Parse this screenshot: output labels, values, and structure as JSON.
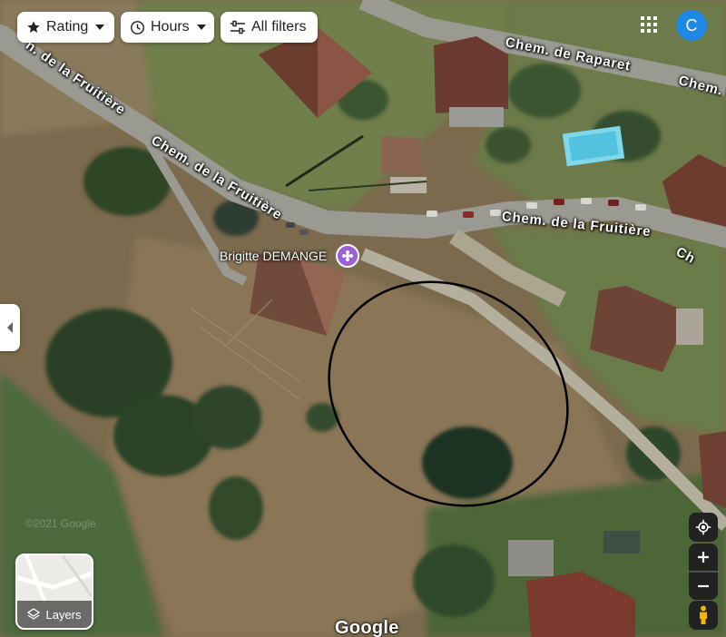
{
  "filters": {
    "rating_label": "Rating",
    "hours_label": "Hours",
    "all_filters_label": "All filters"
  },
  "account": {
    "initial": "C"
  },
  "roads": {
    "raparet": "Chem. de Raparet",
    "raparet_edge": "Chem.",
    "fruitiere_upper_left": "n. de la Fruitière",
    "fruitiere_upper": "Chem. de la Fruitière",
    "fruitiere_right": "Chem. de la Fruitière",
    "fruitiere_edge": "Ch"
  },
  "place": {
    "name": "Brigitte DEMANGE",
    "pin_color": "#9c5fd6"
  },
  "layers": {
    "label": "Layers"
  },
  "footer": {
    "copyright": "©2021 Google",
    "logo": "Google"
  },
  "annotation": {
    "shape": "ellipse",
    "color": "#000000"
  }
}
